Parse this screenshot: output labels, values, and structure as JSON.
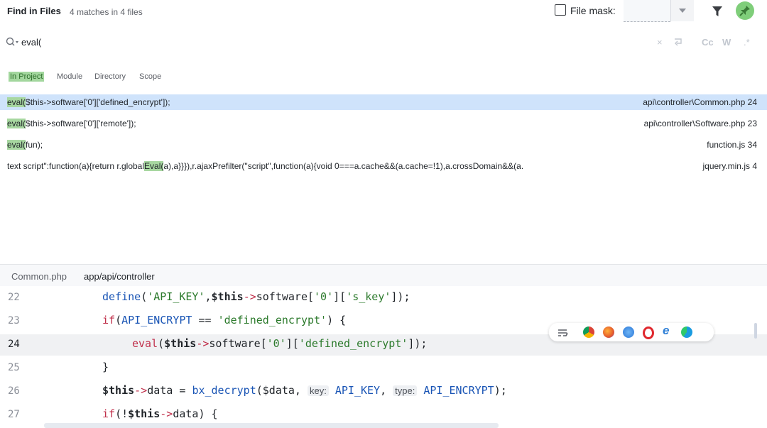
{
  "header": {
    "title": "Find in Files",
    "subtitle": "4 matches in 4 files",
    "file_mask_label": "File mask:"
  },
  "search": {
    "query": "eval("
  },
  "scopes": [
    {
      "label": "In Project",
      "active": true
    },
    {
      "label": "Module",
      "active": false
    },
    {
      "label": "Directory",
      "active": false
    },
    {
      "label": "Scope",
      "active": false
    }
  ],
  "results": [
    {
      "match": "eval(",
      "rest": "$this->software['0']['defined_encrypt']);",
      "location": "api\\controller\\Common.php 24",
      "selected": true
    },
    {
      "match": "eval(",
      "rest": "$this->software['0']['remote']);",
      "location": "api\\controller\\Software.php 23",
      "selected": false
    },
    {
      "match": "eval(",
      "rest": "fun);",
      "location": "function.js 34",
      "selected": false
    },
    {
      "pre": "text script\":function(a){return r.global",
      "match": "Eval(",
      "rest": "a),a}}}),r.ajaxPrefilter(\"script\",function(a){void 0===a.cache&&(a.cache=!1),a.crossDomain&&(a.",
      "location": "jquery.min.js 4",
      "selected": false
    }
  ],
  "preview": {
    "file": "Common.php",
    "path": "app/api/controller"
  },
  "code_lines": [
    {
      "num": "22"
    },
    {
      "num": "23"
    },
    {
      "num": "24"
    },
    {
      "num": "25"
    },
    {
      "num": "26"
    },
    {
      "num": "27"
    }
  ],
  "code_text": {
    "l22": {
      "fn": "define",
      "a": "(",
      "s1": "'API_KEY'",
      "b": ",",
      "this": "$this",
      "arrow": "->",
      "c": "software[",
      "s2": "'0'",
      "d": "][",
      "s3": "'s_key'",
      "e": "]);"
    },
    "l23": {
      "k": "if",
      "a": "(",
      "c1": "API_ENCRYPT",
      "b": " == ",
      "s": "'defined_encrypt'",
      "e": ") {"
    },
    "l24": {
      "k": "eval",
      "a": "(",
      "this": "$this",
      "arrow": "->",
      "c": "software[",
      "s1": "'0'",
      "d": "][",
      "s2": "'defined_encrypt'",
      "e": "]);"
    },
    "l25": {
      "t": "}"
    },
    "l26": {
      "this": "$this",
      "arrow": "->",
      "a": "data = ",
      "fn": "bx_decrypt",
      "b": "($data, ",
      "h1": "key:",
      "c1": "API_KEY",
      "c": ", ",
      "h2": "type:",
      "c2": "API_ENCRYPT",
      "e": ");"
    },
    "l27": {
      "k": "if",
      "a": "(!",
      "this": "$this",
      "arrow": "->",
      "b": "data) {"
    }
  },
  "colors": {
    "accent_green": "#7fce7a",
    "selection": "#cfe3fb",
    "match_highlight": "#a7d7a0"
  },
  "icons": [
    "search-icon",
    "filter-icon",
    "pin-icon",
    "clear-icon",
    "wrap-icon",
    "chevron-down-icon"
  ]
}
